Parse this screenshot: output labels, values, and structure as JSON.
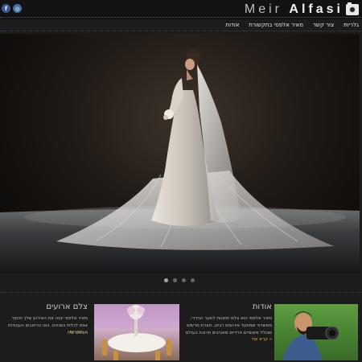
{
  "header": {
    "logo_first": "Meir",
    "logo_last": "Alfasi",
    "social": [
      {
        "name": "facebook",
        "glyph": "f"
      },
      {
        "name": "instagram",
        "glyph": "◎"
      }
    ]
  },
  "nav": {
    "items": [
      "גלריות",
      "צור קשר",
      "מאיר אלפסי בתקשורת",
      "אודות"
    ]
  },
  "slider": {
    "count": 4,
    "active": 0
  },
  "about": {
    "title": "אודות",
    "text": "מאיר אלפסי הוא צלם חתונות לנוער החרדי, מאשדוד שמתעד אירועים רבים, ויוצרת מרשים שכולל פיצוציים חרדיים מאביבים פרוכת בעולם",
    "read_more": "קרא עוד"
  },
  "events": {
    "title": "צלם ארועים",
    "text": "מאיר אלפסי יבנה את האירוע שלך ויכסף אותו לכלתי נשכחת. באו הרחובים העבודות הצלום שלו",
    "read_more": "הגדרות"
  },
  "colors": {
    "accent": "#e0b23a",
    "background": "#1c1c1c"
  }
}
